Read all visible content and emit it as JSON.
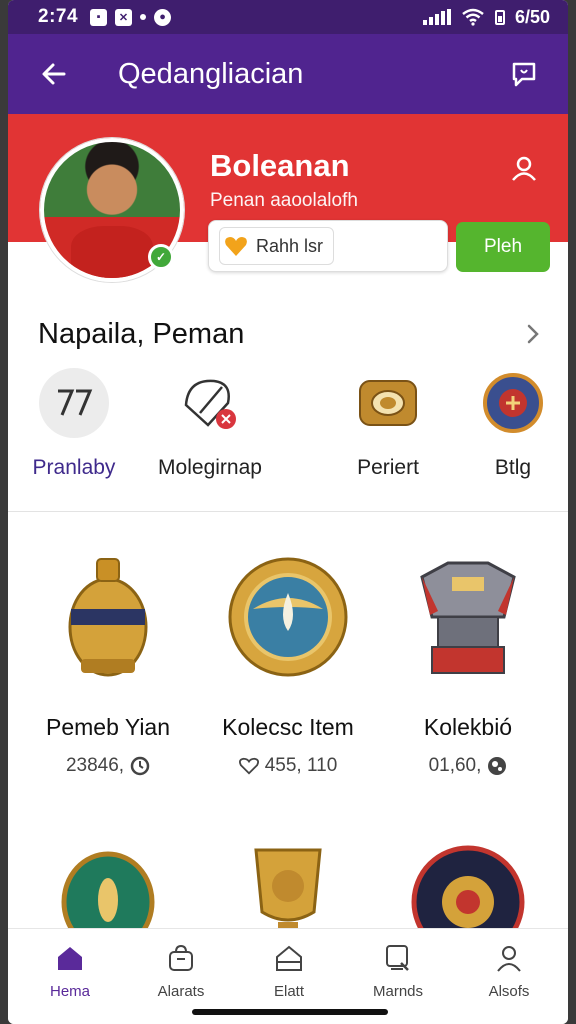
{
  "status_bar": {
    "time": "2:74",
    "battery": "6/50"
  },
  "app_bar": {
    "title": "Qedangliacian"
  },
  "profile": {
    "name": "Boleanan",
    "subtitle": "Penan aaoolalofh",
    "rating_label": "Rahh lsr",
    "action_label": "Pleh"
  },
  "section": {
    "title": "Napaila, Peman",
    "categories": [
      {
        "label": "Pranlaby",
        "icon": "badge-icon",
        "active": true
      },
      {
        "label": "Molegirnap",
        "icon": "tag-icon",
        "active": false
      },
      {
        "label": "Periert",
        "icon": "ring-icon",
        "active": false
      },
      {
        "label": "Btlg",
        "icon": "shield-icon",
        "active": false
      }
    ]
  },
  "items": [
    {
      "title": "Pemeb Yian",
      "meta": "23846,",
      "meta_icon": "clock-icon"
    },
    {
      "title": "Kolecsc Item",
      "meta": "455, 110",
      "meta_icon": "heart-outline-icon"
    },
    {
      "title": "Kolekbió",
      "meta": "01,60,",
      "meta_icon": "globe-icon"
    }
  ],
  "bottom_nav": [
    {
      "label": "Hema",
      "icon": "home-icon",
      "active": true
    },
    {
      "label": "Alarats",
      "icon": "bag-icon",
      "active": false
    },
    {
      "label": "Elatt",
      "icon": "house-outline-icon",
      "active": false
    },
    {
      "label": "Marnds",
      "icon": "search-icon",
      "active": false
    },
    {
      "label": "Alsofs",
      "icon": "person-icon",
      "active": false
    }
  ],
  "colors": {
    "app_bar": "#50248f",
    "status_bar": "#3f1e6e",
    "header_red": "#e13434",
    "action_green": "#55b52e",
    "active_purple": "#5a2a9a"
  }
}
